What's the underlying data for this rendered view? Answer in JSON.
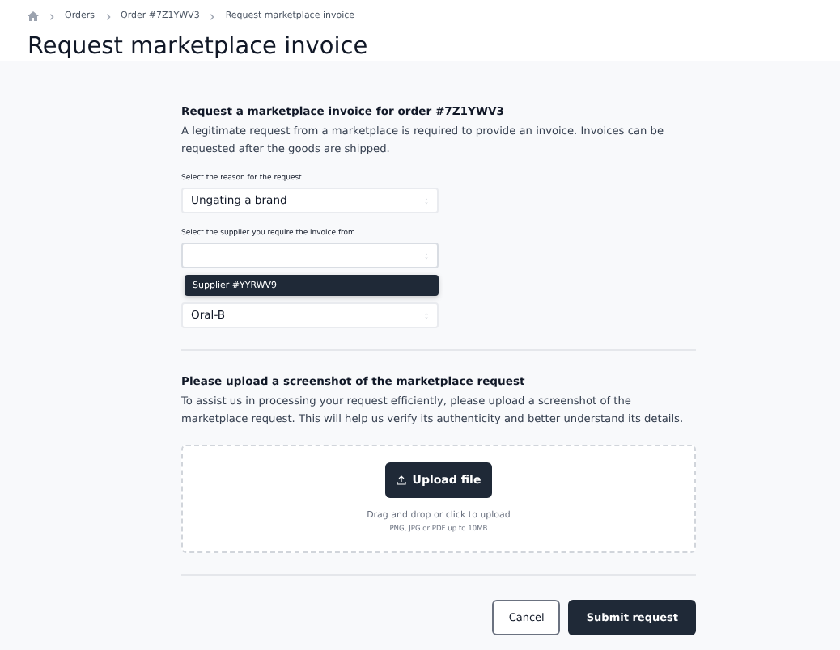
{
  "breadcrumb": [
    {
      "label": "Orders"
    },
    {
      "label": "Order #7Z1YWV3"
    },
    {
      "label": "Request marketplace invoice"
    }
  ],
  "title": "Request marketplace invoice",
  "request_section": {
    "heading": "Request a marketplace invoice for order #7Z1YWV3",
    "description": "A legitimate request from a marketplace is required to provide an invoice. Invoices can be requested after the goods are shipped.",
    "selects": [
      {
        "label": "Select the reason for the request",
        "value": "Ungating a brand"
      },
      {
        "label": "Select the supplier you require the invoice from",
        "expanded": true,
        "options": [
          {
            "label": "Supplier #YYRWV9",
            "selected": true
          }
        ]
      },
      {
        "value": "Oral-B"
      }
    ]
  },
  "upload_section": {
    "heading": "Please upload a screenshot of the marketplace request",
    "description": "To assist us in processing your request efficiently, please upload a screenshot of the marketplace request. This will help us verify its authenticity and better understand its details.",
    "button": "Upload file",
    "hint": "Drag and drop or click to upload",
    "formats": "PNG, JPG or PDF up to 10MB"
  },
  "actions": {
    "cancel": "Cancel",
    "submit": "Submit request"
  }
}
